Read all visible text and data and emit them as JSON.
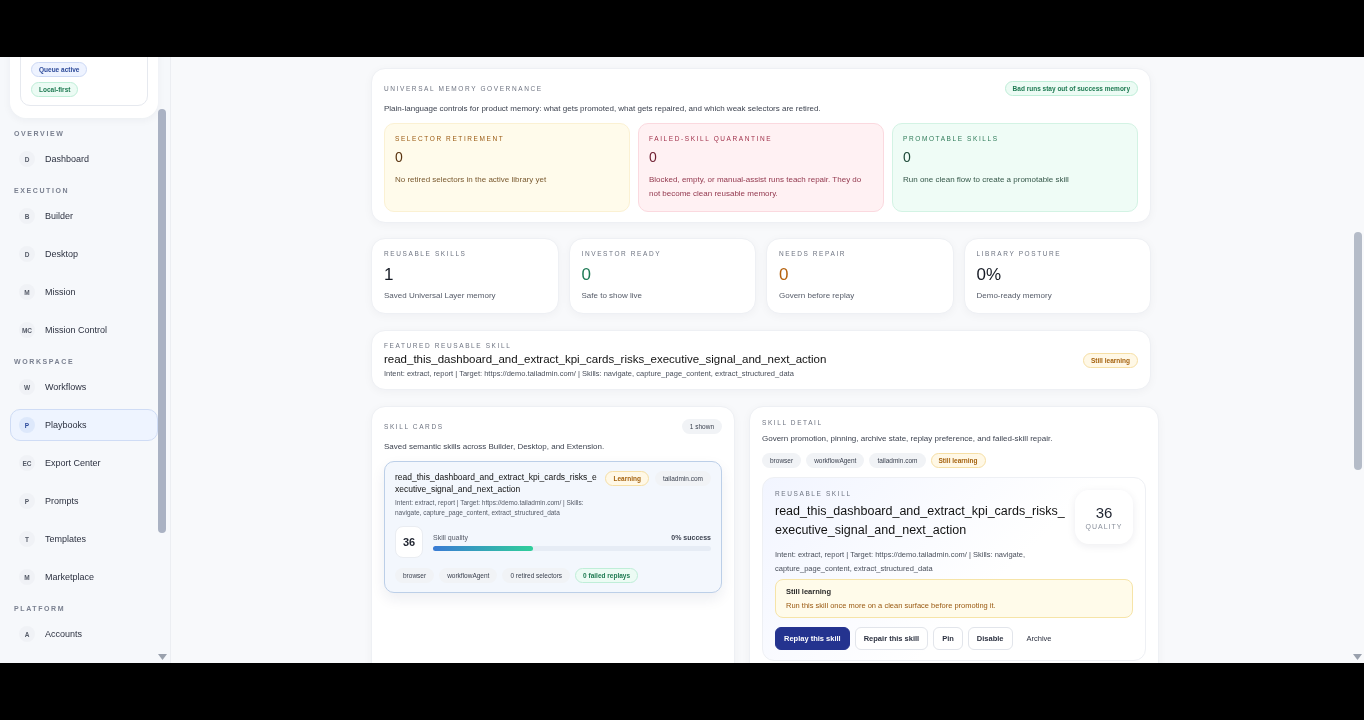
{
  "sidebar": {
    "status_badges": [
      {
        "label": "Queue active",
        "kind": "info"
      },
      {
        "label": "Local-first",
        "kind": "good"
      }
    ],
    "sections": [
      {
        "title": "OVERVIEW",
        "items": [
          {
            "letter": "D",
            "label": "Dashboard",
            "selected": false
          }
        ]
      },
      {
        "title": "EXECUTION",
        "items": [
          {
            "letter": "B",
            "label": "Builder",
            "selected": false
          },
          {
            "letter": "D",
            "label": "Desktop",
            "selected": false
          },
          {
            "letter": "M",
            "label": "Mission",
            "selected": false
          },
          {
            "letter": "MC",
            "label": "Mission Control",
            "selected": false
          }
        ]
      },
      {
        "title": "WORKSPACE",
        "items": [
          {
            "letter": "W",
            "label": "Workflows",
            "selected": false
          },
          {
            "letter": "P",
            "label": "Playbooks",
            "selected": true
          },
          {
            "letter": "EC",
            "label": "Export Center",
            "selected": false
          },
          {
            "letter": "P",
            "label": "Prompts",
            "selected": false
          },
          {
            "letter": "T",
            "label": "Templates",
            "selected": false
          },
          {
            "letter": "M",
            "label": "Marketplace",
            "selected": false
          }
        ]
      },
      {
        "title": "PLATFORM",
        "items": [
          {
            "letter": "A",
            "label": "Accounts",
            "selected": false
          }
        ]
      }
    ]
  },
  "governance": {
    "title": "UNIVERSAL MEMORY GOVERNANCE",
    "description": "Plain-language controls for product memory: what gets promoted, what gets repaired, and which weak selectors are retired.",
    "badge": "Bad runs stay out of success memory",
    "tiles": [
      {
        "kind": "amber",
        "label": "SELECTOR RETIREMENT",
        "value": "0",
        "note": "No retired selectors in the active library yet"
      },
      {
        "kind": "rose",
        "label": "FAILED-SKILL QUARANTINE",
        "value": "0",
        "note": "Blocked, empty, or manual-assist runs teach repair. They do not become clean reusable memory."
      },
      {
        "kind": "green",
        "label": "PROMOTABLE SKILLS",
        "value": "0",
        "note": "Run one clean flow to create a promotable skill"
      }
    ]
  },
  "stats": [
    {
      "kind": "neutral",
      "label": "REUSABLE SKILLS",
      "value": "1",
      "note": "Saved Universal Layer memory"
    },
    {
      "kind": "good",
      "label": "INVESTOR READY",
      "value": "0",
      "note": "Safe to show live"
    },
    {
      "kind": "warn",
      "label": "NEEDS REPAIR",
      "value": "0",
      "note": "Govern before replay"
    },
    {
      "kind": "neutral",
      "label": "LIBRARY POSTURE",
      "value": "0%",
      "note": "Demo-ready memory"
    }
  ],
  "featured": {
    "label": "FEATURED REUSABLE SKILL",
    "name": "read_this_dashboard_and_extract_kpi_cards_risks_executive_signal_and_next_action",
    "meta": "Intent: extract, report | Target: https://demo.tailadmin.com/ | Skills: navigate, capture_page_content, extract_structured_data",
    "badge": "Still learning"
  },
  "skill_cards": {
    "title": "SKILL CARDS",
    "description": "Saved semantic skills across Builder, Desktop, and Extension.",
    "count": "1 shown",
    "cards": [
      {
        "name": "read_this_dashboard_and_extract_kpi_cards_risks_executive_signal_and_next_action",
        "status": "Learning",
        "domain": "tailadmin.com",
        "meta": "Intent: extract, report | Target: https://demo.tailadmin.com/ | Skills: navigate, capture_page_content, extract_structured_data",
        "score": "36",
        "quality_label": "Skill quality",
        "level": 0.36,
        "success": "0% success",
        "tags": [
          {
            "label": "browser",
            "kind": "plain"
          },
          {
            "label": "workflowAgent",
            "kind": "plain"
          },
          {
            "label": "0 retired selectors",
            "kind": "plain"
          },
          {
            "label": "0 failed replays",
            "kind": "good"
          }
        ]
      }
    ]
  },
  "skill_detail": {
    "title": "SKILL DETAIL",
    "description": "Govern promotion, pinning, archive state, replay preference, and failed-skill repair.",
    "tags": [
      {
        "label": "browser",
        "kind": "plain"
      },
      {
        "label": "workflowAgent",
        "kind": "plain"
      },
      {
        "label": "tailadmin.com",
        "kind": "plain"
      },
      {
        "label": "Still learning",
        "kind": "warn"
      }
    ],
    "label": "REUSABLE SKILL",
    "name": "read_this_dashboard_and_extract_kpi_cards_risks_executive_signal_and_next_action",
    "score": "36",
    "score_label": "QUALITY",
    "meta": "Intent: extract, report | Target: https://demo.tailadmin.com/ | Skills: navigate, capture_page_content, extract_structured_data",
    "alert": {
      "title": "Still learning",
      "text": "Run this skill once more on a clean surface before promoting it."
    },
    "buttons": [
      {
        "label": "Replay this skill",
        "kind": "primary"
      },
      {
        "label": "Repair this skill",
        "kind": "outline"
      },
      {
        "label": "Pin",
        "kind": "outline"
      },
      {
        "label": "Disable",
        "kind": "outline"
      },
      {
        "label": "Archive",
        "kind": "plain"
      }
    ]
  }
}
